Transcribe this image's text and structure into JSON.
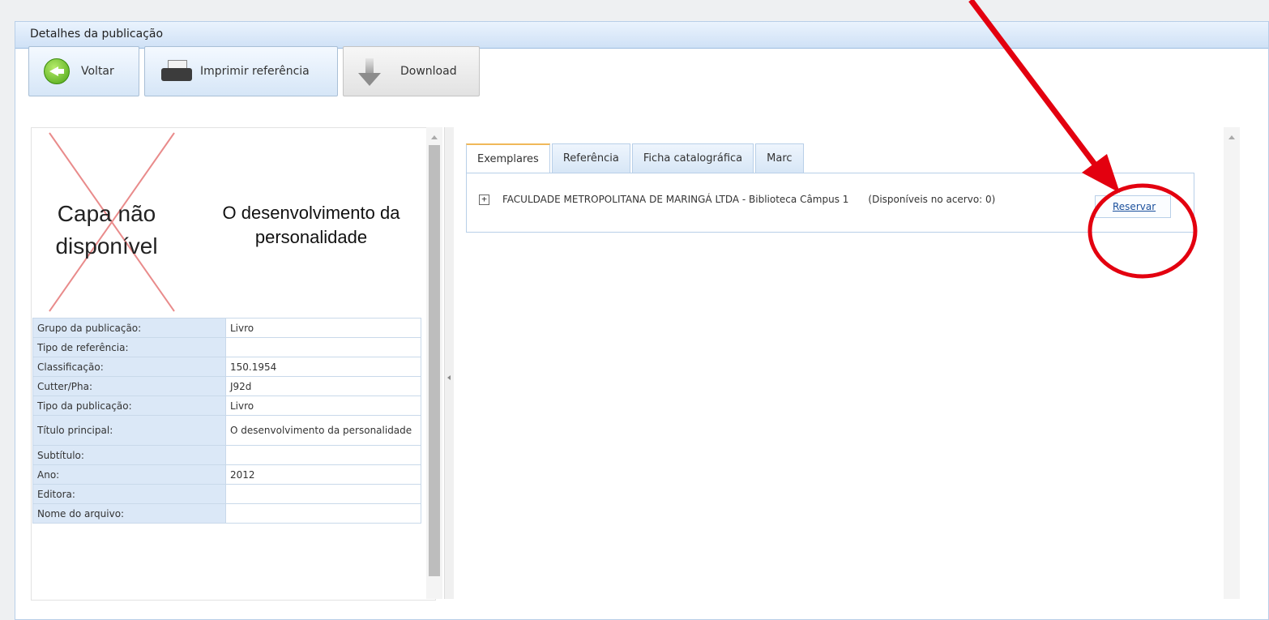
{
  "window": {
    "title": "Detalhes da publicação"
  },
  "toolbar": {
    "back_label": "Voltar",
    "print_label": "Imprimir referência",
    "download_label": "Download"
  },
  "icons": {
    "back": "arrow-left-circle-icon",
    "print": "printer-icon",
    "download": "download-arrow-icon"
  },
  "cover": {
    "placeholder_text": "Capa não disponível"
  },
  "book": {
    "title": "O desenvolvimento da personalidade"
  },
  "properties": [
    {
      "key": "Grupo da publicação:",
      "value": "Livro"
    },
    {
      "key": "Tipo de referência:",
      "value": ""
    },
    {
      "key": "Classificação:",
      "value": "150.1954"
    },
    {
      "key": "Cutter/Pha:",
      "value": "J92d"
    },
    {
      "key": "Tipo da publicação:",
      "value": "Livro"
    },
    {
      "key": "Título principal:",
      "value": "O desenvolvimento da personalidade"
    },
    {
      "key": "Subtítulo:",
      "value": ""
    },
    {
      "key": "Ano:",
      "value": "2012"
    },
    {
      "key": "Editora:",
      "value": ""
    },
    {
      "key": "Nome do arquivo:",
      "value": ""
    }
  ],
  "tabs": [
    {
      "label": "Exemplares",
      "active": true
    },
    {
      "label": "Referência"
    },
    {
      "label": "Ficha catalográfica"
    },
    {
      "label": "Marc"
    }
  ],
  "exemplares": {
    "expand_symbol": "+",
    "library": "FACULDADE METROPOLITANA DE MARINGÁ LTDA - Biblioteca Câmpus 1",
    "availability": "(Disponíveis no acervo: 0)",
    "reserve_label": "Reservar"
  },
  "colors": {
    "annotation": "#e3000f",
    "link": "#1a4f9c",
    "tab_highlight": "#f0b85a"
  }
}
